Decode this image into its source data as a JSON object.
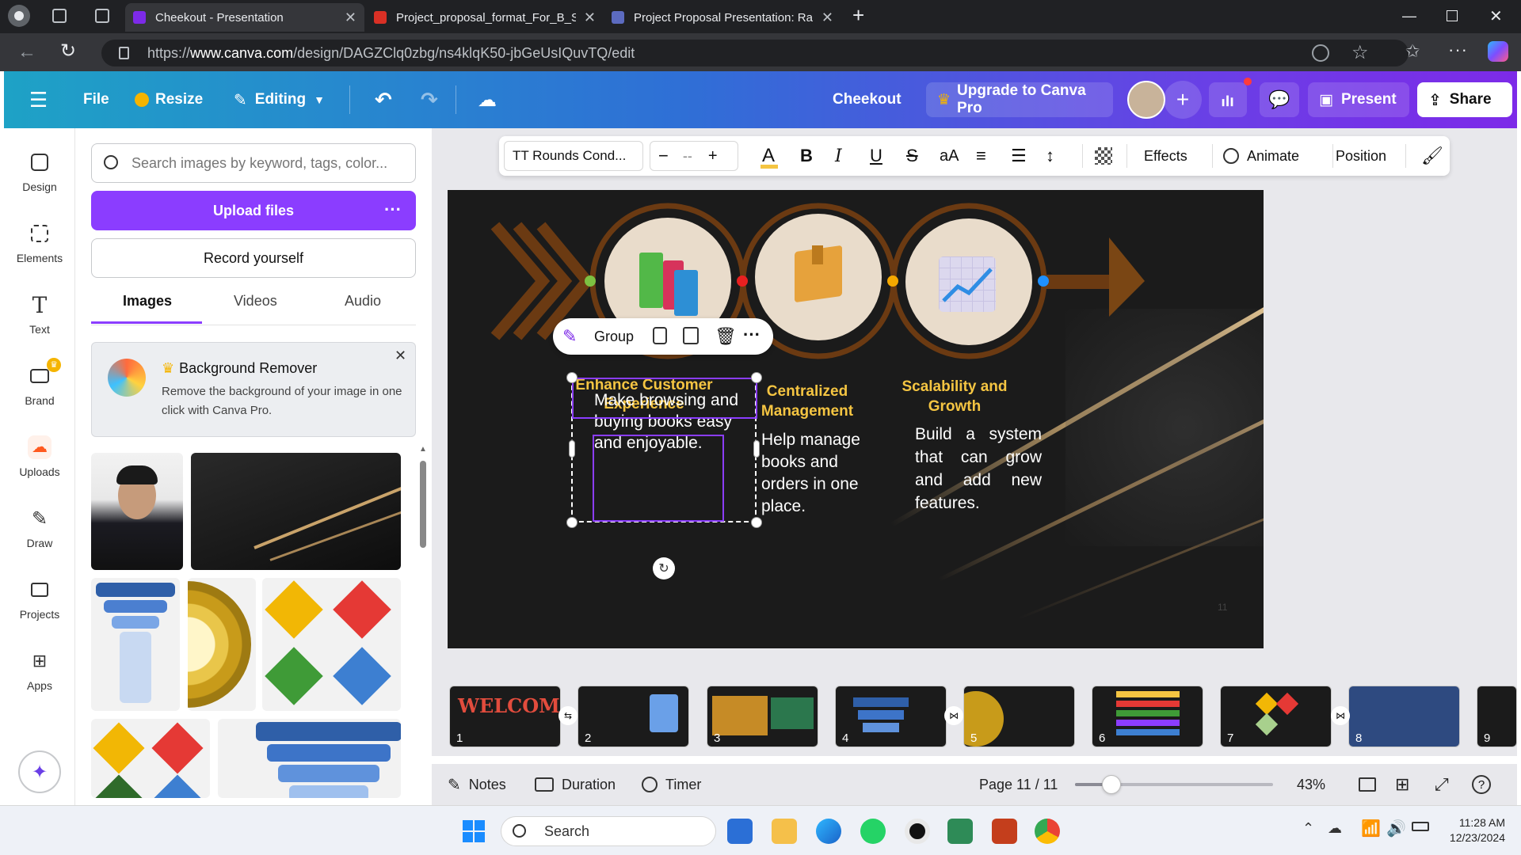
{
  "browser": {
    "tabs": [
      {
        "title": "Cheekout - Presentation",
        "active": true
      },
      {
        "title": "Project_proposal_format_For_B_Sc",
        "active": false
      },
      {
        "title": "Project Proposal Presentation: Ra",
        "active": false
      }
    ],
    "url_prefix": "https://",
    "url_domain": "www.canva.com",
    "url_path": "/design/DAGZClq0zbg/ns4klqK50-jbGeUsIQuvTQ/edit"
  },
  "header": {
    "file_label": "File",
    "resize_label": "Resize",
    "editing_label": "Editing",
    "doc_title": "Cheekout",
    "upgrade_label": "Upgrade to Canva Pro",
    "present_label": "Present",
    "share_label": "Share"
  },
  "rail": {
    "items": [
      {
        "label": "Design",
        "icon": "design-icon"
      },
      {
        "label": "Elements",
        "icon": "elements-icon"
      },
      {
        "label": "Text",
        "icon": "text-icon"
      },
      {
        "label": "Brand",
        "icon": "brand-icon"
      },
      {
        "label": "Uploads",
        "icon": "uploads-icon"
      },
      {
        "label": "Draw",
        "icon": "draw-icon"
      },
      {
        "label": "Projects",
        "icon": "projects-icon"
      },
      {
        "label": "Apps",
        "icon": "apps-icon"
      }
    ]
  },
  "panel": {
    "search_placeholder": "Search images by keyword, tags, color...",
    "upload_label": "Upload files",
    "record_label": "Record yourself",
    "tabs": [
      "Images",
      "Videos",
      "Audio"
    ],
    "active_tab": "Images",
    "bg_remover": {
      "title": "Background Remover",
      "description": "Remove the background of your image in one click with Canva Pro."
    }
  },
  "toolbar": {
    "font": "TT Rounds Cond...",
    "size_value": "-- ",
    "effects_label": "Effects",
    "animate_label": "Animate",
    "position_label": "Position"
  },
  "group_toolbar": {
    "group_label": "Group"
  },
  "slide": {
    "columns": [
      {
        "heading": "Enhance Customer Experience",
        "body": "Make browsing and buying books easy and enjoyable.",
        "icon": "books-icon"
      },
      {
        "heading": "Centralized Management",
        "body": "Help manage books and orders in one place.",
        "icon": "package-icon"
      },
      {
        "heading": "Scalability and Growth",
        "body": "Build a system that can grow and add new features.",
        "icon": "growth-chart-icon"
      }
    ],
    "page_marker": "11",
    "colors": {
      "heading": "#f5c542",
      "body": "#ffffff",
      "ring": "#6b3a12",
      "circle": "#e9dccb"
    }
  },
  "thumbnails": [
    {
      "num": "1",
      "caption": "WELCOME"
    },
    {
      "num": "2",
      "caption": ""
    },
    {
      "num": "3",
      "caption": ""
    },
    {
      "num": "4",
      "caption": ""
    },
    {
      "num": "5",
      "caption": ""
    },
    {
      "num": "6",
      "caption": ""
    },
    {
      "num": "7",
      "caption": ""
    },
    {
      "num": "8",
      "caption": ""
    },
    {
      "num": "9",
      "caption": ""
    }
  ],
  "footer": {
    "notes_label": "Notes",
    "duration_label": "Duration",
    "timer_label": "Timer",
    "page_label": "Page 11 / 11",
    "zoom_value": 43,
    "zoom_label": "43%"
  },
  "taskbar": {
    "search_label": "Search",
    "time": "11:28 AM",
    "date": "12/23/2024"
  }
}
